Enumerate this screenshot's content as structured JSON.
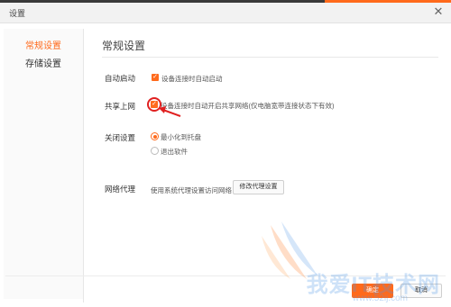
{
  "window": {
    "title": "设置",
    "close_glyph": "✕"
  },
  "colors": {
    "accent": "#ff6a1c",
    "annotation": "#e02020",
    "watermark": "#5096e6"
  },
  "sidebar": {
    "items": [
      {
        "label": "常规设置",
        "active": true
      },
      {
        "label": "存储设置",
        "active": false
      }
    ]
  },
  "main": {
    "section_title": "常规设置",
    "autostart": {
      "label": "自动启动",
      "option": "设备连接时自动启动",
      "checked": true
    },
    "share": {
      "label": "共享上网",
      "option": "设备连接时自动开启共享网络(仅电脑宽带连接状态下有效)",
      "checked": true
    },
    "close": {
      "label": "关闭设置",
      "options": [
        {
          "label": "最小化到托盘",
          "selected": true
        },
        {
          "label": "退出软件",
          "selected": false
        }
      ]
    },
    "proxy": {
      "label": "网络代理",
      "description": "使用系统代理设置访问网络",
      "button": "修改代理设置"
    }
  },
  "footer": {
    "confirm": "确定",
    "cancel": "取消"
  },
  "watermark": {
    "text": "我爱IT技术网",
    "url": "www.52ij.com"
  },
  "icons": {
    "check": "checkmark-icon",
    "close": "close-icon",
    "arrow": "annotation-arrow-icon"
  }
}
